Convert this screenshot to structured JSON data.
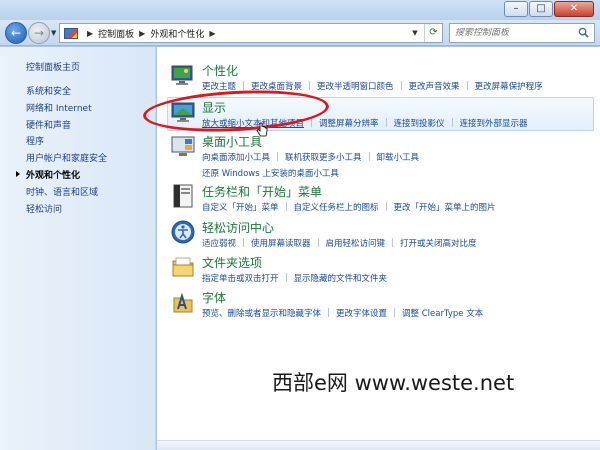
{
  "window": {
    "minimize_glyph": "–",
    "maximize_glyph": "□",
    "close_glyph": "✕"
  },
  "navigation": {
    "back_glyph": "←",
    "forward_glyph": "→",
    "address": {
      "breadcrumbs": [
        "控制面板",
        "外观和个性化"
      ],
      "separator": "▶"
    },
    "search_placeholder": "搜索控制面板"
  },
  "sidebar": {
    "home_label": "控制面板主页",
    "items": [
      {
        "label": "系统和安全",
        "current": false
      },
      {
        "label": "网络和 Internet",
        "current": false
      },
      {
        "label": "硬件和声音",
        "current": false
      },
      {
        "label": "程序",
        "current": false
      },
      {
        "label": "用户帐户和家庭安全",
        "current": false
      },
      {
        "label": "外观和个性化",
        "current": true
      },
      {
        "label": "时钟、语言和区域",
        "current": false
      },
      {
        "label": "轻松访问",
        "current": false
      }
    ]
  },
  "categories": [
    {
      "title": "个性化",
      "icon": "personalization-icon",
      "links": [
        "更改主题",
        "更改桌面背景",
        "更改半透明窗口颜色",
        "更改声音效果",
        "更改屏幕保护程序"
      ]
    },
    {
      "title": "显示",
      "icon": "display-icon",
      "highlighted": true,
      "links": [
        "放大或缩小文本和其他项目",
        "调整屏幕分辨率",
        "连接到投影仪",
        "连接到外部显示器"
      ]
    },
    {
      "title": "桌面小工具",
      "icon": "gadgets-icon",
      "links": [
        "向桌面添加小工具",
        "联机获取更多小工具",
        "卸载小工具"
      ],
      "links_row2": [
        "还原 Windows 上安装的桌面小工具"
      ]
    },
    {
      "title": "任务栏和「开始」菜单",
      "icon": "taskbar-icon",
      "links": [
        "自定义「开始」菜单",
        "自定义任务栏上的图标",
        "更改「开始」菜单上的图片"
      ]
    },
    {
      "title": "轻松访问中心",
      "icon": "ease-of-access-icon",
      "links": [
        "适应弱视",
        "使用屏幕读取器",
        "启用轻松访问键",
        "打开或关闭高对比度"
      ]
    },
    {
      "title": "文件夹选项",
      "icon": "folder-options-icon",
      "links": [
        "指定单击或双击打开",
        "显示隐藏的文件和文件夹"
      ]
    },
    {
      "title": "字体",
      "icon": "fonts-icon",
      "links": [
        "预览、删除或者显示和隐藏字体",
        "更改字体设置",
        "调整 ClearType 文本"
      ]
    }
  ],
  "watermark": "西部e网 www.weste.net",
  "colors": {
    "category_title": "#1a7a3a",
    "link": "#1a4aa3",
    "annotation_circle": "#e0161d"
  }
}
